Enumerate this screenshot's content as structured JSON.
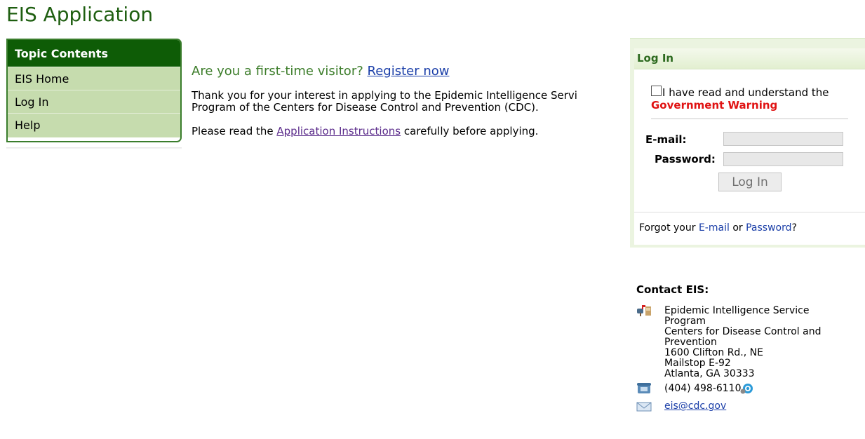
{
  "app_title": "EIS Application",
  "sidebar": {
    "header": "Topic Contents",
    "items": [
      {
        "label": "EIS Home"
      },
      {
        "label": "Log In"
      },
      {
        "label": "Help"
      }
    ]
  },
  "main": {
    "headline_prefix": "Are you a first-time visitor?",
    "register_link": "Register now",
    "paragraph1_line1": "Thank you for your interest in applying to the Epidemic Intelligence Servi",
    "paragraph1_line2": "Program of the Centers for Disease Control and Prevention (CDC).",
    "paragraph2_prefix": "Please read the",
    "instructions_link": "Application Instructions",
    "paragraph2_suffix": "carefully before applying."
  },
  "login": {
    "header": "Log In",
    "warning_text": "I have read and understand the",
    "government_warning": "Government Warning",
    "email_label": "E-mail:",
    "email_value": "",
    "password_label": "Password:",
    "password_value": "",
    "button_label": "Log In",
    "footer_prefix": "Forgot your",
    "footer_email_link": "E-mail",
    "footer_or": "or",
    "footer_password_link": "Password",
    "footer_suffix": "?"
  },
  "contact": {
    "title": "Contact EIS:",
    "address_lines": [
      "Epidemic Intelligence Service",
      "Program",
      "Centers for Disease Control and",
      "Prevention",
      "1600 Clifton Rd., NE",
      "Mailstop E-92",
      "Atlanta, GA 30333"
    ],
    "phone": "(404) 498-6110",
    "email": "eis@cdc.gov"
  },
  "colors": {
    "title_green": "#1e5e10",
    "sidebar_header": "#0e5c06",
    "sidebar_item_bg": "#c6dcae",
    "link_blue": "#1a3ea8",
    "visited_purple": "#5a2a8a",
    "warning_red": "#e01212"
  },
  "icons": {
    "address": "mailbox-icon",
    "phone": "phone-icon",
    "skype": "skype-icon",
    "email": "envelope-icon"
  }
}
